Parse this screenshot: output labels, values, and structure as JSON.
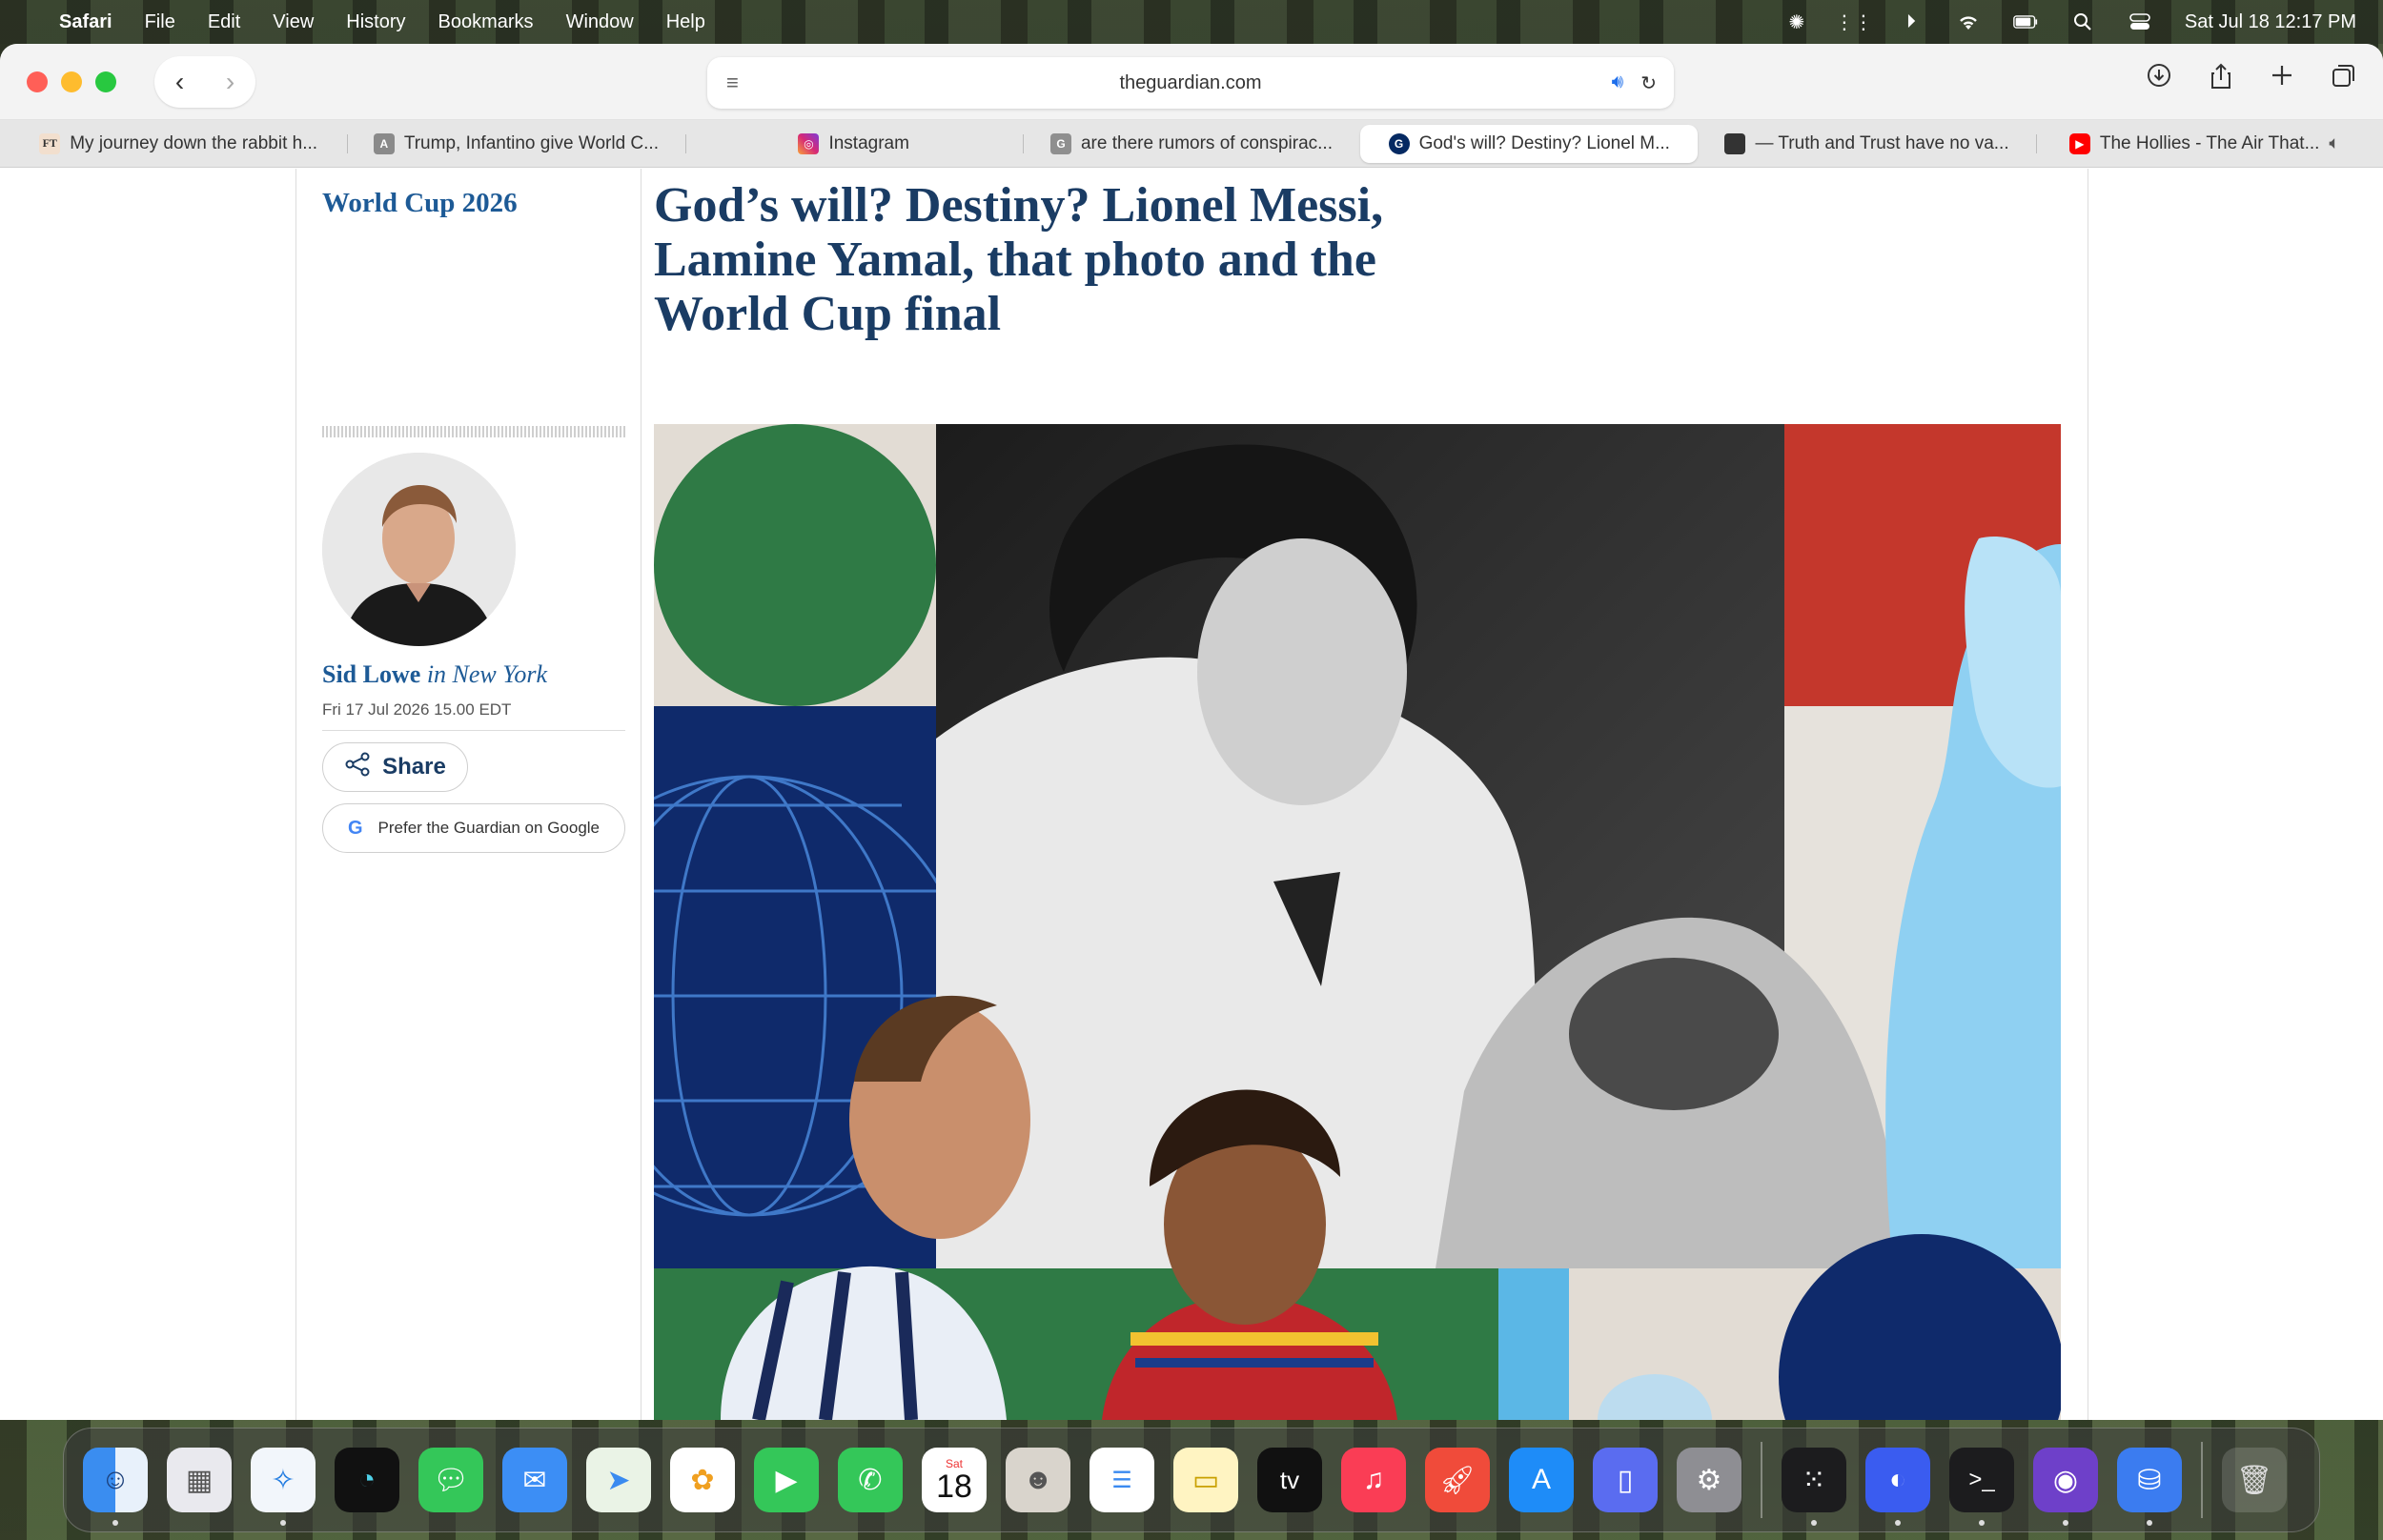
{
  "menubar": {
    "app": "Safari",
    "items": [
      "File",
      "Edit",
      "View",
      "History",
      "Bookmarks",
      "Window",
      "Help"
    ],
    "clock": "Sat Jul 18  12:17 PM"
  },
  "browser": {
    "url": "theguardian.com",
    "tabs": [
      {
        "title": "My journey down the rabbit h...",
        "favicon": "FT"
      },
      {
        "title": "Trump, Infantino give World C...",
        "favicon": "A"
      },
      {
        "title": "Instagram",
        "favicon": ""
      },
      {
        "title": "are there rumors of conspirac...",
        "favicon": "G"
      },
      {
        "title": "God's will? Destiny? Lionel M...",
        "favicon": "",
        "active": true
      },
      {
        "title": "— Truth and Trust have no va...",
        "favicon": ""
      },
      {
        "title": "The Hollies - The Air That...",
        "favicon": "",
        "audio": true
      }
    ]
  },
  "article": {
    "section": "World Cup 2026",
    "headline": "God’s will? Destiny? Lionel Messi, Lamine Yamal, that photo and the World Cup final",
    "author": "Sid Lowe",
    "location_prefix": "in",
    "location": "New York",
    "date": "Fri 17 Jul 2026 15.00 EDT",
    "share_label": "Share",
    "google_label": "Prefer the Guardian on Google"
  },
  "dock": {
    "calendar_month": "Sat",
    "calendar_day": "18",
    "tv_label": "tv"
  },
  "colors": {
    "guardian_blue": "#1a3c64",
    "section_blue": "#1d5a96",
    "hero_green": "#2f7a45",
    "hero_navy": "#0f2a6b",
    "hero_red": "#c4372c",
    "hero_sky": "#5bb7e6"
  }
}
